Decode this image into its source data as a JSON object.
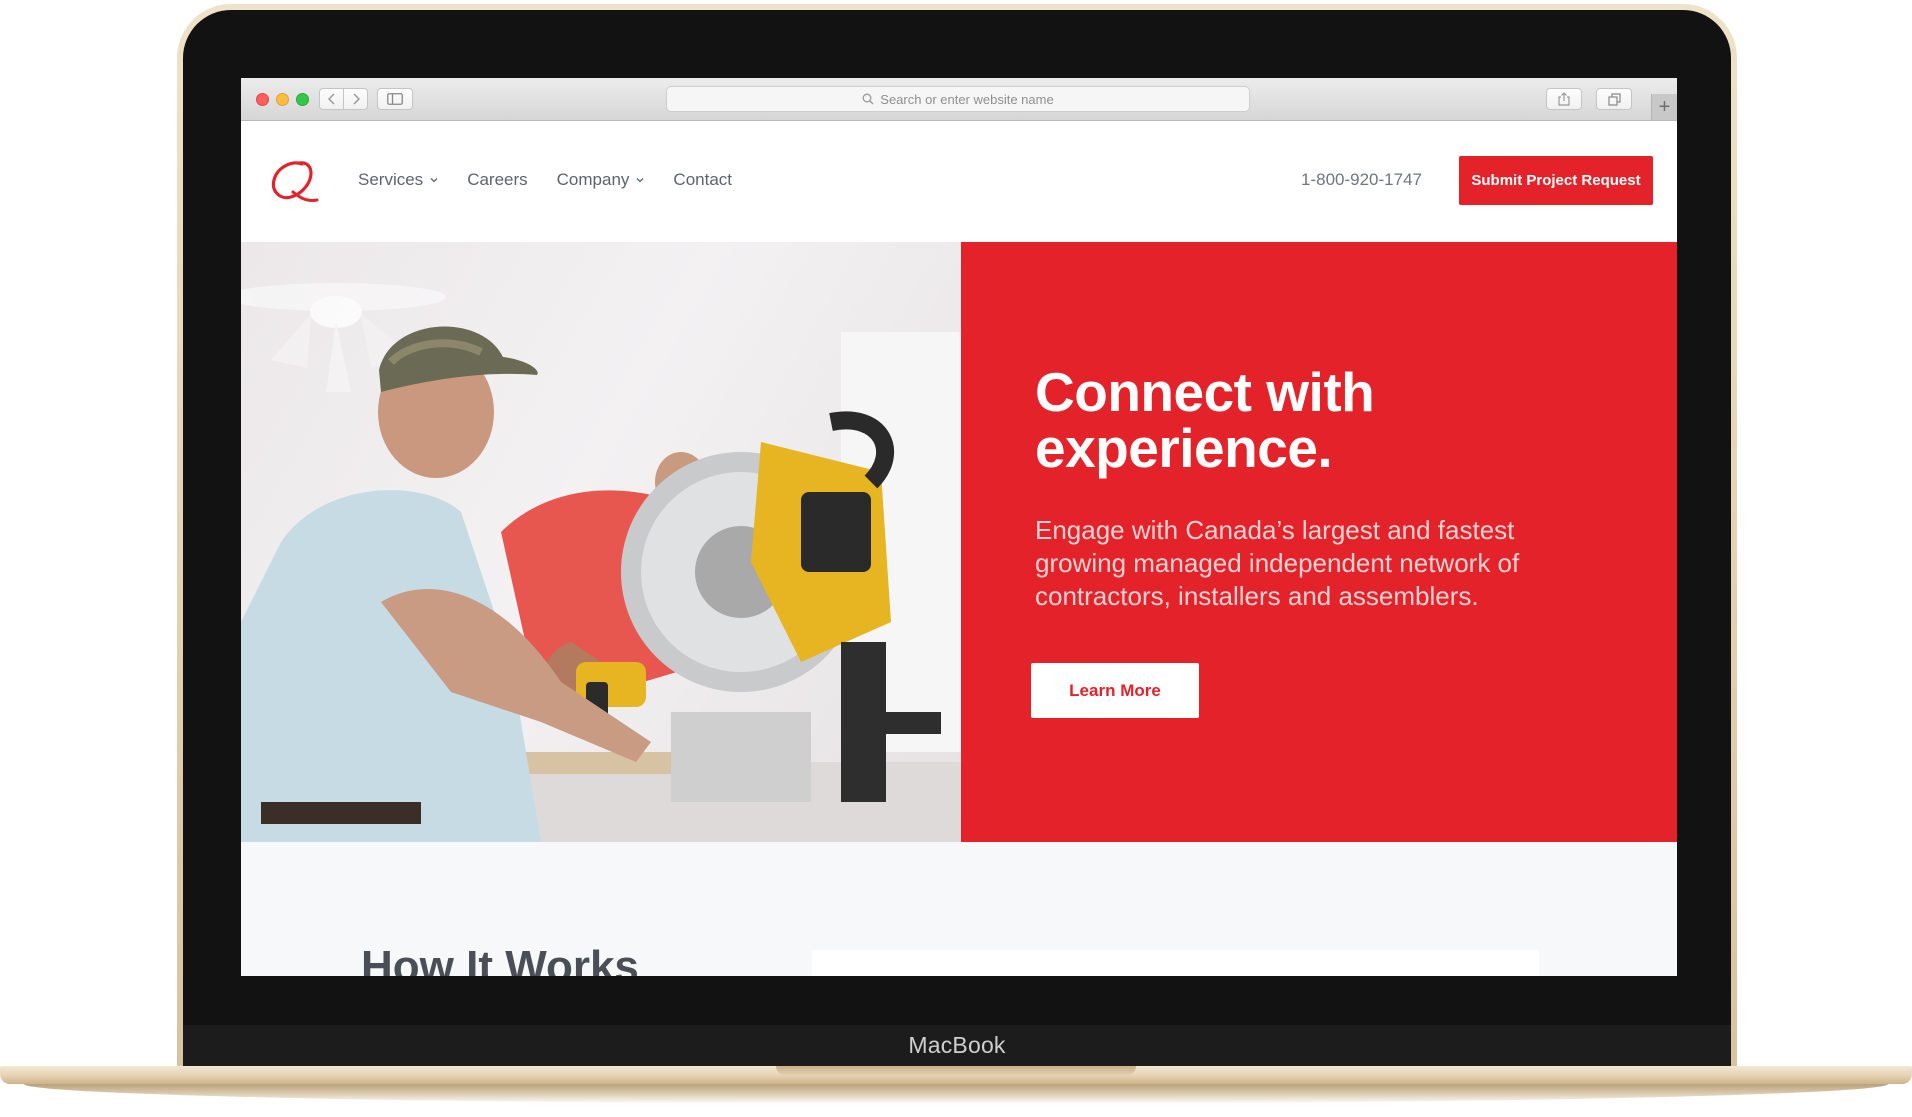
{
  "device": {
    "label": "MacBook"
  },
  "browser": {
    "address_placeholder": "Search or enter website name",
    "new_tab_glyph": "+"
  },
  "site": {
    "nav": {
      "services": "Services",
      "careers": "Careers",
      "company": "Company",
      "contact": "Contact"
    },
    "phone": "1-800-920-1747",
    "cta_label": "Submit Project Request"
  },
  "hero": {
    "title_line1": "Connect with",
    "title_line2": "experience.",
    "text": "Engage with Canada’s largest and fastest growing managed independent network of contractors, installers and assemblers.",
    "button_label": "Learn More"
  },
  "section": {
    "title": "How It Works"
  },
  "colors": {
    "brand_red": "#e32229",
    "nav_text": "#5d6470"
  },
  "icons": [
    "search-icon",
    "chevron-left-icon",
    "chevron-right-icon",
    "sidebar-icon",
    "share-icon",
    "tabs-icon",
    "chevron-down-icon",
    "q-logo"
  ]
}
